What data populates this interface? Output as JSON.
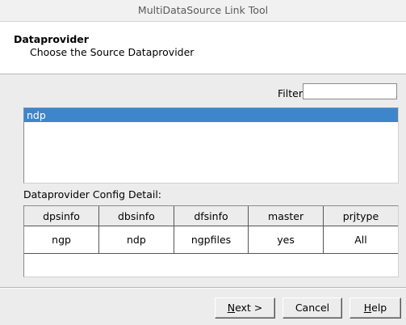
{
  "window": {
    "title": "MultiDataSource Link Tool"
  },
  "header": {
    "title": "Dataprovider",
    "subtitle": "Choose the Source Dataprovider"
  },
  "filter": {
    "label": "Filter:",
    "value": ""
  },
  "dataproviders": {
    "items": [
      {
        "label": "ndp",
        "selected": true
      }
    ]
  },
  "config": {
    "label": "Dataprovider Config Detail:",
    "columns": [
      "dpsinfo",
      "dbsinfo",
      "dfsinfo",
      "master",
      "prjtype"
    ],
    "rows": [
      [
        "ngp",
        "ndp",
        "ngpfiles",
        "yes",
        "All"
      ]
    ]
  },
  "buttons": {
    "next": {
      "mnemonic": "N",
      "rest": "ext >"
    },
    "cancel": {
      "label": "Cancel"
    },
    "help": {
      "mnemonic": "H",
      "rest": "elp"
    }
  },
  "colors": {
    "selection": "#3d86cc",
    "window_bg": "#ececec",
    "header_bg": "#ffffff"
  }
}
